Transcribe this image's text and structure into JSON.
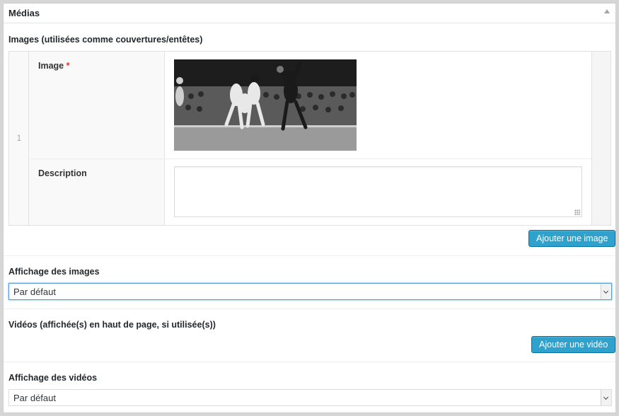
{
  "panel": {
    "title": "Médias"
  },
  "images_field": {
    "label": "Images (utilisées comme couvertures/entêtes)",
    "row_number": "1",
    "image_label": "Image",
    "required_mark": "*",
    "description_label": "Description",
    "description_value": "",
    "add_button": "Ajouter une image"
  },
  "image_display": {
    "label": "Affichage des images",
    "selected": "Par défaut"
  },
  "videos_field": {
    "label": "Vidéos (affichée(s) en haut de page, si utilisée(s))",
    "add_button": "Ajouter une vidéo"
  },
  "video_display": {
    "label": "Affichage des vidéos",
    "selected": "Par défaut"
  },
  "colors": {
    "button": "#2ea2cc",
    "required": "#dc3232",
    "focus": "#5b9dd9"
  }
}
